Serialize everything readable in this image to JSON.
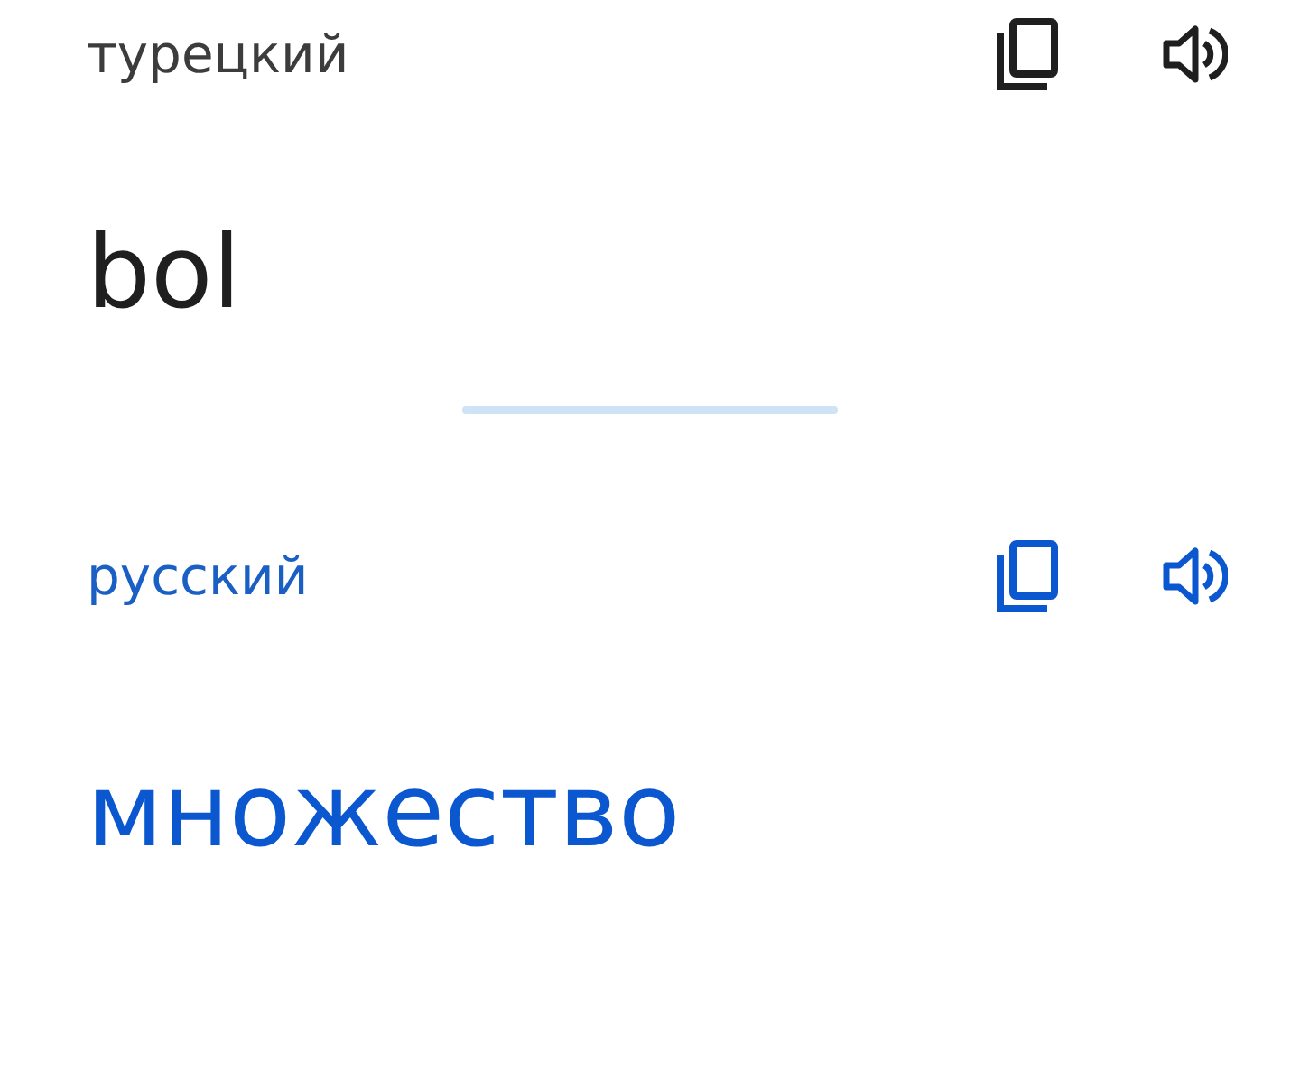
{
  "panels": [
    {
      "kind": "source",
      "language": "турецкий",
      "text": "bol"
    },
    {
      "kind": "target",
      "language": "русский",
      "text": "множество"
    }
  ]
}
